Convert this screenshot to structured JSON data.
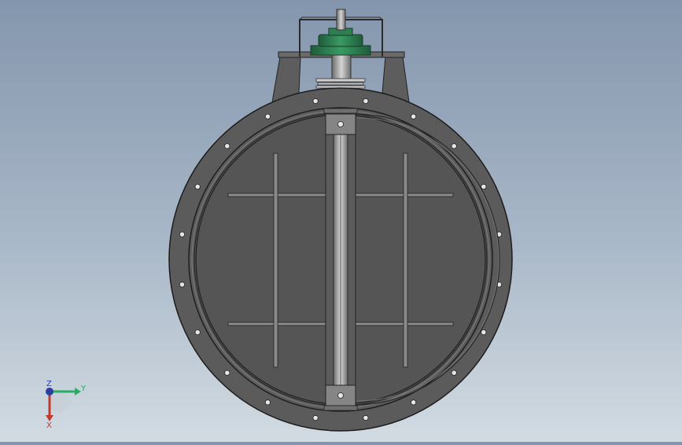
{
  "model": {
    "colors": {
      "background_top": "#8496ad",
      "background_bottom": "#d2dbe2",
      "body": "#5b5b5b",
      "edge": "#222222",
      "actuator": "#2e7d4f",
      "shaft": "#a8a8a8",
      "bolt_hole": "#e6e6e6"
    },
    "flange_bolt_holes": 20
  },
  "triad": {
    "label_y": "Y",
    "label_z": "Z",
    "label_x": "X",
    "color_x": "#c0392b",
    "color_y": "#27ae60",
    "color_z": "#2c3e9e"
  }
}
